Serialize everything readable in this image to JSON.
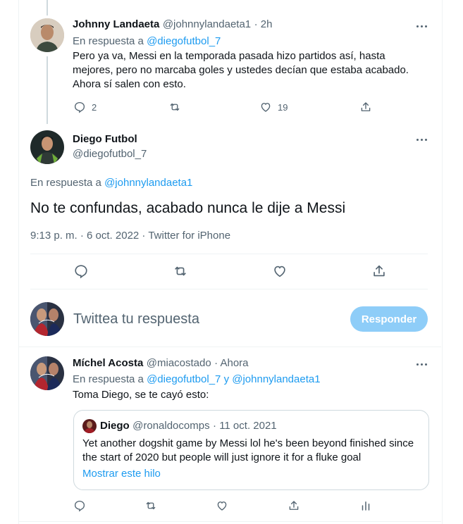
{
  "reply1": {
    "name": "Johnny Landaeta",
    "handle": "@johnnylandaeta1",
    "time": "· 2h",
    "replying_prefix": "En respuesta a",
    "replying_to": "@diegofutbol_7",
    "text": "Pero ya va, Messi en la temporada pasada hizo partidos así, hasta mejores, pero no marcaba goles y ustedes decían que estaba acabado. Ahora sí salen con esto.",
    "reply_count": "2",
    "like_count": "19"
  },
  "main": {
    "name": "Diego Futbol",
    "handle": "@diegofutbol_7",
    "replying_prefix": "En respuesta a",
    "replying_to": "@johnnylandaeta1",
    "text": "No te confundas, acabado nunca le dije a Messi",
    "meta": "9:13 p. m. · 6 oct. 2022 · Twitter for iPhone"
  },
  "composer": {
    "placeholder": "Twittea tu respuesta",
    "button_label": "Responder"
  },
  "reply2": {
    "name": "Míchel Acosta",
    "handle": "@miacostado",
    "time": "· Ahora",
    "replying_prefix": "En respuesta a",
    "replying_to_1": "@diegofutbol_7",
    "and": "y",
    "replying_to_2": "@johnnylandaeta1",
    "text": "Toma Diego, se te cayó esto:",
    "quote": {
      "name": "Diego",
      "handle": "@ronaldocomps",
      "time": "· 11 oct. 2021",
      "text": "Yet another dogshit game by Messi lol he's been beyond finished since the start of 2020 but people will just ignore it for a fluke goal",
      "show_thread": "Mostrar este hilo"
    }
  },
  "colors": {
    "accent": "#1d9bf0",
    "button_disabled": "#8ecdf8",
    "muted": "#536471",
    "text": "#0f1419",
    "border": "#eff3f4"
  }
}
